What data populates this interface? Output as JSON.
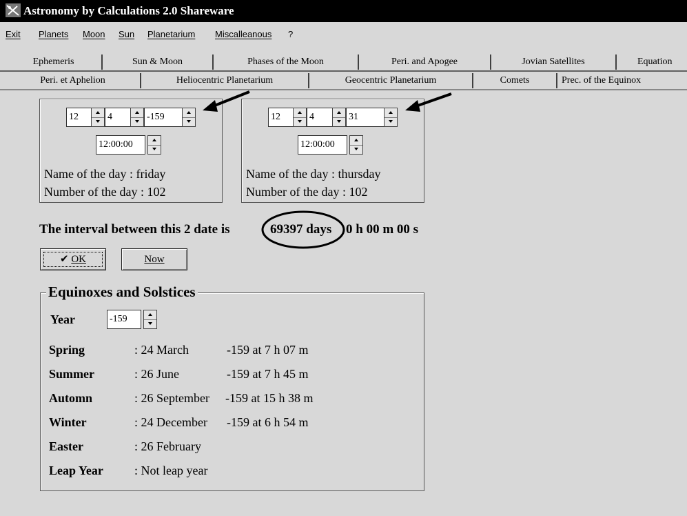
{
  "window": {
    "title": "Astronomy by Calculations 2.0  Shareware"
  },
  "menu": [
    "Exit",
    "Planets",
    "Moon",
    "Sun",
    "Planetarium",
    "Miscalleanous",
    "?"
  ],
  "tabs_row1": [
    "Ephemeris",
    "Sun & Moon",
    "Phases of the Moon",
    "Peri. and Apogee",
    "Jovian Satellites",
    "Equation"
  ],
  "tabs_row2": [
    "Peri. et Aphelion",
    "Heliocentric Planetarium",
    "Geocentric Planetarium",
    "Comets",
    "Prec. of the Equinox"
  ],
  "date1": {
    "day": "12",
    "month": "4",
    "year": "-159",
    "time": "12:00:00",
    "name_of_day": "Name of the day : friday",
    "number_of_day": "Number of the day : 102"
  },
  "date2": {
    "day": "12",
    "month": "4",
    "year": "31",
    "time": "12:00:00",
    "name_of_day": "Name of the day : thursday",
    "number_of_day": "Number of the day : 102"
  },
  "interval": {
    "prefix": "The interval between this 2 date is",
    "days": "69397 days",
    "suffix": "0 h 00 m 00 s"
  },
  "buttons": {
    "ok": "OK",
    "now": "Now"
  },
  "equinoxes": {
    "title": "Equinoxes and Solstices",
    "year_label": "Year",
    "year_value": "-159",
    "rows": [
      {
        "label": "Spring",
        "date": ": 24 March",
        "detail": "-159 at 7 h 07 m"
      },
      {
        "label": "Summer",
        "date": ": 26 June",
        "detail": "-159 at 7 h 45 m"
      },
      {
        "label": "Automn",
        "date": ": 26 September",
        "detail": "-159 at 15 h 38 m"
      },
      {
        "label": "Winter",
        "date": ": 24 December",
        "detail": "-159 at 6 h 54 m"
      },
      {
        "label": "Easter",
        "date": ": 26 February",
        "detail": ""
      },
      {
        "label": "Leap Year",
        "date": ": Not leap year",
        "detail": ""
      }
    ]
  },
  "colors": {
    "background": "#d8d8d8",
    "titlebar": "#000000"
  }
}
